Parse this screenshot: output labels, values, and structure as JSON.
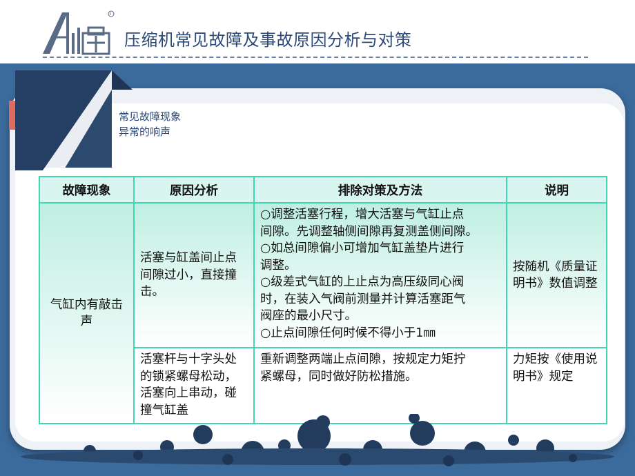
{
  "header": {
    "title": "压缩机常见故障及事故原因分析与对策",
    "logo_icon": "company-logo-icon"
  },
  "section": {
    "subtitle": "常见故障现象",
    "topic": "异常的响声"
  },
  "table": {
    "headers": [
      "故障现象",
      "原因分析",
      "排除对策及方法",
      "说明"
    ],
    "phenomenon": "气缸内有敲击声",
    "rows": [
      {
        "cause": "活塞与缸盖间止点间隙过小，直接撞击。",
        "measures": [
          "○调整活塞行程，增大活塞与气缸止点",
          "间隙。先调整轴侧间隙再复测盖侧间隙。",
          "○如总间隙偏小可增加气缸盖垫片进行",
          "调整。",
          "○级差式气缸的上止点为高压级同心阀",
          "时，在装入气阀前测量并计算活塞距气",
          "阀座的最小尺寸。",
          "○止点间隙任何时候不得小于1㎜"
        ],
        "note": "按随机《质量证明书》数值调整"
      },
      {
        "cause": "活塞杆与十字头处的锁紧螺母松动，活塞向上串动，碰撞气缸盖",
        "measures": [
          "重新调整两端止点间隙，按规定力矩拧",
          "紧螺母，同时做好防松措施。"
        ],
        "note": "力矩按《使用说明书》规定"
      }
    ]
  },
  "colors": {
    "background": "#3b6a9c",
    "table_border": "#3fd6b2",
    "header_fill": "#d8f6ef",
    "title_text": "#2e4a78"
  }
}
